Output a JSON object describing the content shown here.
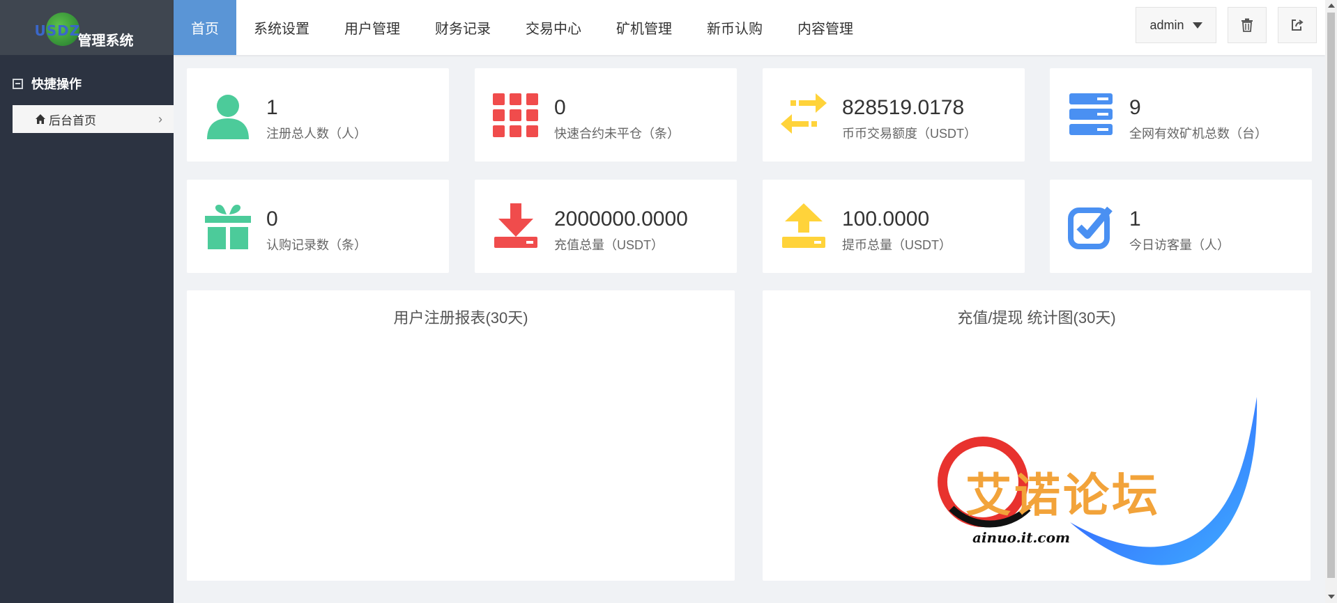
{
  "app": {
    "logo_mark": "USDZ",
    "logo_name": "管理系统"
  },
  "sidebar": {
    "section_title": "快捷操作",
    "items": [
      {
        "label": "后台首页",
        "icon": "home-icon"
      }
    ]
  },
  "nav": {
    "items": [
      {
        "label": "首页",
        "active": true
      },
      {
        "label": "系统设置"
      },
      {
        "label": "用户管理"
      },
      {
        "label": "财务记录"
      },
      {
        "label": "交易中心"
      },
      {
        "label": "矿机管理"
      },
      {
        "label": "新币认购"
      },
      {
        "label": "内容管理"
      }
    ]
  },
  "topright": {
    "user": "admin",
    "icons": [
      "trash-icon",
      "logout-icon"
    ]
  },
  "stats": [
    {
      "value": "1",
      "label": "注册总人数（人）",
      "icon": "user-icon",
      "color": "#4ccb9a"
    },
    {
      "value": "0",
      "label": "快速合约未平仓（条）",
      "icon": "grid-icon",
      "color": "#f04c4c"
    },
    {
      "value": "828519.0178",
      "label": "币币交易额度（USDT）",
      "icon": "swap-arrows-icon",
      "color": "#ffd33a"
    },
    {
      "value": "9",
      "label": "全网有效矿机总数（台）",
      "icon": "server-icon",
      "color": "#4a90f2"
    },
    {
      "value": "0",
      "label": "认购记录数（条）",
      "icon": "gift-icon",
      "color": "#4ccb9a"
    },
    {
      "value": "2000000.0000",
      "label": "充值总量（USDT）",
      "icon": "download-icon",
      "color": "#f04c4c"
    },
    {
      "value": "100.0000",
      "label": "提币总量（USDT）",
      "icon": "upload-icon",
      "color": "#ffd33a"
    },
    {
      "value": "1",
      "label": "今日访客量（人）",
      "icon": "check-square-icon",
      "color": "#4a90f2"
    }
  ],
  "panels": {
    "left_title": "用户注册报表(30天)",
    "right_title": "充值/提现 统计图(30天)"
  },
  "watermark": {
    "text": "艾诺论坛",
    "url": "ainuo.it.com"
  }
}
